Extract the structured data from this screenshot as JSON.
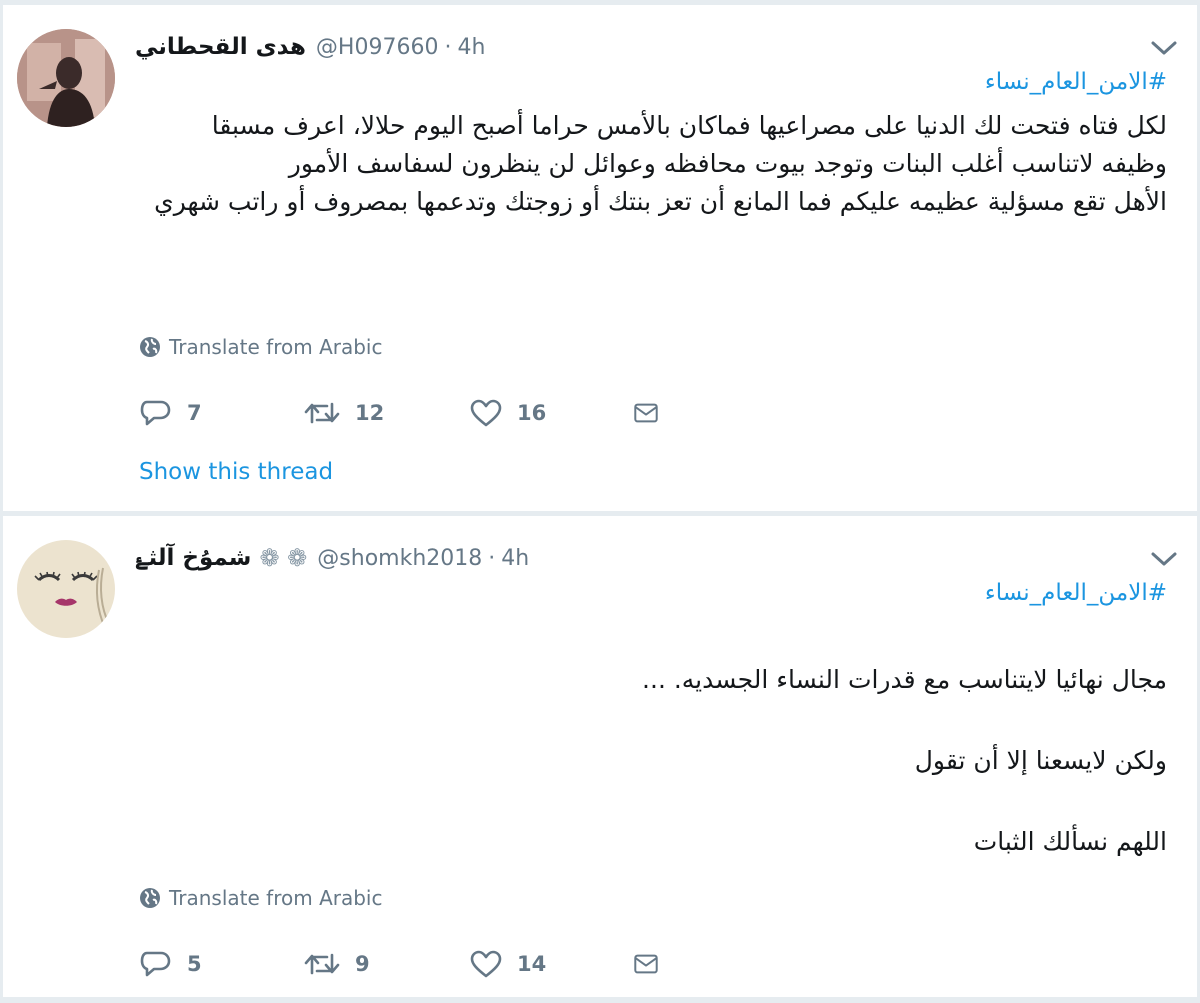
{
  "colors": {
    "link": "#1b95e0",
    "secondary_text": "#657786",
    "primary_text": "#14171a",
    "background": "#e6ecf0",
    "card": "#ffffff"
  },
  "tweets": [
    {
      "display_name": "هدى القحطاني",
      "username": "@H097660",
      "separator": "·",
      "time": "4h",
      "hashtag": "#الامن_العام_نساء",
      "text": "لكل فتاه فتحت لك الدنيا على مصراعيها فماكان بالأمس حراما أصبح اليوم حلالا، اعرف مسبقا وظيفه لاتناسب أغلب البنات وتوجد بيوت محافظه وعوائل لن ينظرون لسفاسف الأمور",
      "text_2": "الأهل تقع مسؤلية عظيمه عليكم فما المانع أن تعز بنتك أو زوجتك وتدعمها بمصروف أو راتب شهري",
      "translate_label": "Translate from Arabic",
      "reply_count": "7",
      "retweet_count": "12",
      "like_count": "16",
      "show_thread": "Show this thread",
      "icons": [
        "globe-icon",
        "reply-icon",
        "retweet-icon",
        "heart-icon",
        "envelope-icon",
        "chevron-down-icon"
      ]
    },
    {
      "display_name": "شمۇخ آلثۓ",
      "badges": "❁ ❁",
      "username": "@shomkh2018",
      "separator": "·",
      "time": "4h",
      "hashtag": "#الامن_العام_نساء",
      "para_1": "مجال نهائيا لايتناسب مع قدرات النساء الجسديه. ...",
      "para_2": "ولكن لايسعنا إلا أن تقول",
      "para_3": "اللهم نسألك الثبات",
      "translate_label": "Translate from Arabic",
      "reply_count": "5",
      "retweet_count": "9",
      "like_count": "14",
      "icons": [
        "globe-icon",
        "reply-icon",
        "retweet-icon",
        "heart-icon",
        "envelope-icon",
        "chevron-down-icon"
      ]
    }
  ]
}
